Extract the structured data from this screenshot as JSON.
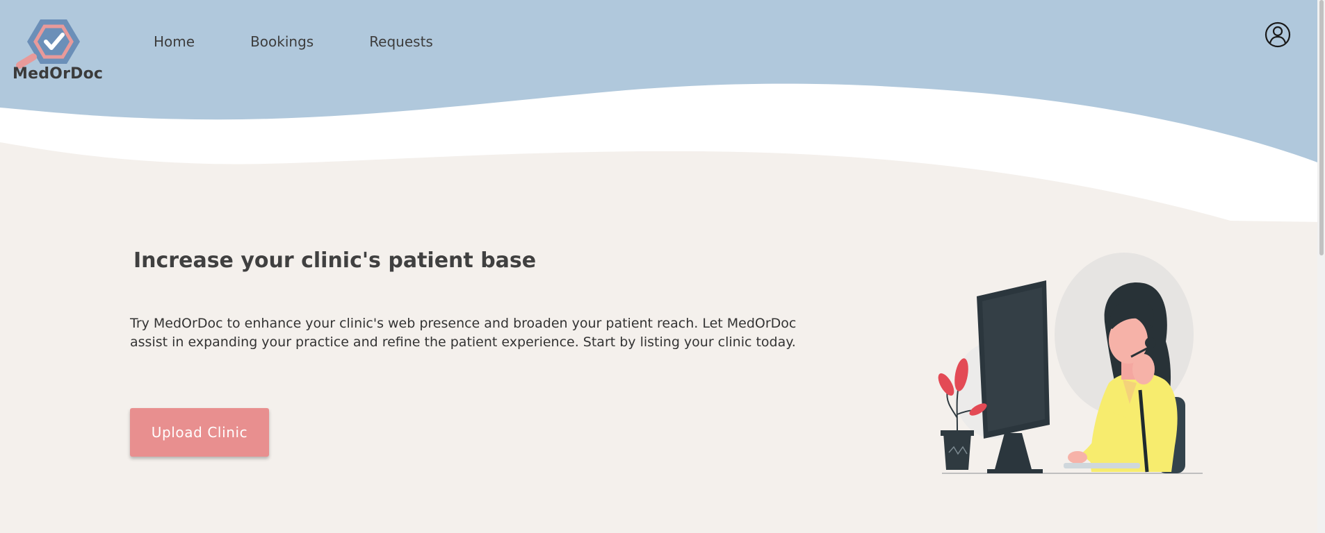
{
  "brand": {
    "name": "MedOrDoc",
    "logo_icon": "hexagon-checkmark-magnifier-icon"
  },
  "nav": {
    "items": [
      {
        "label": "Home"
      },
      {
        "label": "Bookings"
      },
      {
        "label": "Requests"
      }
    ]
  },
  "header": {
    "profile_icon": "user-profile-icon"
  },
  "hero": {
    "title": "Increase your clinic's patient base",
    "description": "Try MedOrDoc to enhance your clinic's web presence and broaden your patient reach. Let MedOrDoc assist in expanding your practice and refine the patient experience. Start by listing your clinic today.",
    "cta_label": "Upload Clinic",
    "illustration": "receptionist-at-computer-illustration"
  },
  "colors": {
    "header_bg": "#b0c8dc",
    "page_bg": "#f4f0ec",
    "cta_bg": "#e88f8f",
    "text": "#3d3d3d"
  }
}
